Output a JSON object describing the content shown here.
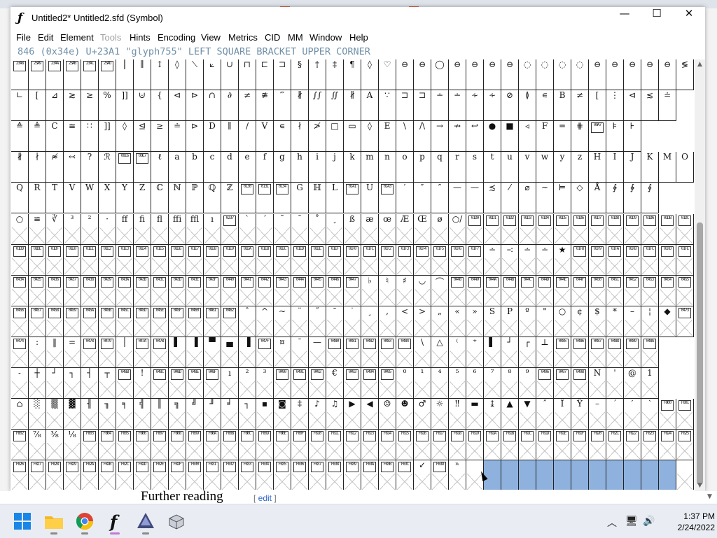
{
  "window": {
    "title": "Untitled2*  Untitled2.sfd (Symbol)",
    "controls": {
      "minimize": "—",
      "maximize": "☐",
      "close": "✕"
    }
  },
  "menu": [
    "File",
    "Edit",
    "Element",
    "Tools",
    "Hints",
    "Encoding",
    "View",
    "Metrics",
    "CID",
    "MM",
    "Window",
    "Help"
  ],
  "info_line": "846 (0x34e) U+23A1 \"glyph755\" LEFT SQUARE BRACKET UPPER CORNER",
  "grid": {
    "rows": [
      [
        "23A8",
        "23A9",
        "23AA",
        "23AB",
        "23AC",
        "23AD",
        "⎮",
        "∥",
        "↕",
        "◊",
        "⟍",
        "⟀",
        "∪",
        "⊓",
        "⊏",
        "⊐",
        "§",
        "†",
        "‡",
        "¶",
        "◊",
        "♡",
        "⊖",
        "⊖",
        "◯",
        "⊖",
        "⊖",
        "⊖",
        "⊖",
        "◌",
        "◌",
        "◌",
        "◌",
        "⊖",
        "⊖",
        "⊖",
        "⊖",
        "⊖",
        "≶"
      ],
      [
        "∟",
        "[",
        "⊿",
        "≳",
        "≥",
        "%",
        "]]",
        "⊍",
        "{",
        "⊲",
        "⊳",
        "∩",
        "∂",
        "≠",
        "≇",
        "‴",
        "∦",
        "∫∫",
        "∬",
        "∦",
        "A",
        "∵",
        "⊐",
        "⊐",
        "∸",
        "∸",
        "∻",
        "∻",
        "⊘",
        "≬",
        "∊",
        "B",
        "≠",
        "[",
        "⋮",
        "⊲",
        "≲",
        "≐"
      ],
      [
        "≙",
        "≜",
        "C",
        "≅",
        "∷",
        "]]",
        "◊",
        "⊴",
        "≥",
        "≐",
        "⊳",
        "D",
        "∥",
        "/",
        "V",
        "∊",
        "∤",
        "≯",
        "□",
        "▭",
        "◊",
        "E",
        "\\",
        "/\\",
        "→",
        "↛",
        "↩",
        "●",
        "■",
        "◃",
        "F",
        "═",
        "⋕",
        "00A7",
        "⊧",
        "⊦"
      ],
      [
        "∦",
        "∤",
        "≉",
        "↢",
        "?",
        "ℛ",
        "00E6",
        "00E7",
        "ℓ",
        "a",
        "b",
        "c",
        "d",
        "e",
        "f",
        "g",
        "h",
        "i",
        "j",
        "k",
        "m",
        "n",
        "o",
        "p",
        "q",
        "r",
        "s",
        "t",
        "u",
        "v",
        "w",
        "y",
        "z",
        "H",
        "I",
        "J",
        "K",
        "M",
        "O"
      ],
      [
        "Q",
        "R",
        "T",
        "V",
        "W",
        "X",
        "Y",
        "Z",
        "ℂ",
        "ℕ",
        "ℙ",
        "ℚ",
        "ℤ",
        "0130",
        "0131",
        "0134",
        "G",
        "ℍ",
        "L",
        "0141",
        "U",
        "0143",
        "′",
        "″",
        "″",
        "—",
        "—",
        "≾",
        "⁄",
        "⌀",
        "∼",
        "⊨",
        "◇",
        "Å",
        "∲",
        "∳",
        "∮"
      ],
      [
        "○",
        "≌",
        "∛",
        "³",
        "²",
        "·",
        "ff",
        "fi",
        "fl",
        "ffi",
        "ffl",
        "ı",
        "0237",
        "`",
        "´",
        "˘",
        "ˉ",
        "˚",
        "¸",
        "ß",
        "æ",
        "œ",
        "Æ",
        "Œ",
        "ø",
        "○/",
        "01D0",
        "01D1",
        "01D2",
        "01D3",
        "01D4",
        "01D5",
        "01D6",
        "01D7",
        "01D8",
        "01D9",
        "01DA",
        "01DB",
        "01DC"
      ],
      [
        "01DD",
        "01DE",
        "01DF",
        "01E0",
        "01E1",
        "01E2",
        "01E3",
        "01E4",
        "01E5",
        "01E6",
        "01E7",
        "01E8",
        "01E9",
        "01EA",
        "01EB",
        "01EC",
        "01ED",
        "01EE",
        "01EF",
        "01F0",
        "01F1",
        "01F2",
        "01F3",
        "01F4",
        "01F5",
        "01F6",
        "01F7",
        "∸",
        "∹",
        "∸",
        "∸",
        "★",
        "01F8",
        "01F9",
        "01FA",
        "01FB",
        "01FC",
        "01FD",
        "01FE"
      ],
      [
        "0434",
        "0435",
        "0436",
        "0437",
        "0438",
        "0439",
        "043A",
        "043B",
        "043C",
        "043D",
        "043E",
        "043F",
        "0440",
        "0441",
        "0442",
        "0443",
        "0444",
        "0445",
        "0446",
        "0447",
        "♭",
        "♮",
        "♯",
        "◡",
        "⌒",
        "0448",
        "0449",
        "044A",
        "044B",
        "044C",
        "044D",
        "044E",
        "044F",
        "0450",
        "0451",
        "0452",
        "0453",
        "0454",
        "0455"
      ],
      [
        "0456",
        "0457",
        "0458",
        "0459",
        "045A",
        "045B",
        "045C",
        "045D",
        "045E",
        "045F",
        "0460",
        "0461",
        "0462",
        "ˆ",
        "^",
        "~",
        "¨",
        "˝",
        "¯",
        "˙",
        "¸",
        ",",
        "<",
        ">",
        "„",
        "«",
        "»",
        "S",
        "P",
        "º",
        "\"",
        "○",
        "¢",
        "$",
        "*",
        "–",
        "¦",
        "◆",
        "0473"
      ],
      [
        "0474",
        ":",
        "‖",
        "=",
        "0478",
        "0479",
        "│",
        "047A",
        "047B",
        "▌",
        "▐",
        "▀",
        "▄",
        "▐",
        "047F",
        "¤",
        "ˉ",
        "—",
        "0480",
        "0481",
        "0482",
        "0483",
        "0484",
        "\\",
        "△",
        "⁽",
        "⁺",
        "▌",
        "┘",
        "┌",
        "⊥",
        "0485",
        "0486",
        "0487",
        "0488",
        "0489",
        "048A"
      ],
      [
        "˗",
        "┼",
        "┘",
        "┐",
        "┤",
        "┬",
        "048B",
        "!",
        "048C",
        "048D",
        "048E",
        "048F",
        "ı",
        "²",
        "³",
        "0490",
        "0491",
        "0492",
        "€",
        "0493",
        "0494",
        "0495",
        "⁰",
        "¹",
        "⁴",
        "⁵",
        "⁶",
        "⁷",
        "⁸",
        "⁹",
        "0496",
        "0497",
        "0498",
        "N",
        "'",
        "@",
        "1"
      ],
      [
        "⌂",
        "░",
        "▒",
        "▓",
        "╢",
        "╖",
        "╕",
        "╣",
        "║",
        "╗",
        "╝",
        "╜",
        "╛",
        "┐",
        "▪",
        "◙",
        "‡",
        "♪",
        "♫",
        "▶",
        "◀",
        "☺",
        "☻",
        "♂",
        "☼",
        "‼",
        "▬",
        "↨",
        "▲",
        "▼",
        "˝",
        "Ï",
        "Ÿ",
        "–",
        "´",
        "′",
        "‵",
        "F800",
        "F801"
      ],
      [
        "F802",
        "⅞",
        "⅜",
        "⅛",
        "F803",
        "F804",
        "F805",
        "F806",
        "F807",
        "F808",
        "F809",
        "F80A",
        "F80B",
        "F80C",
        "F80D",
        "F80E",
        "F80F",
        "F810",
        "F811",
        "F812",
        "F813",
        "F814",
        "F815",
        "F816",
        "F817",
        "F818",
        "F819",
        "F81A",
        "F81B",
        "F81C",
        "F81D",
        "F81E",
        "F81F",
        "F820",
        "F821",
        "F822",
        "F823",
        "F824",
        "F825"
      ],
      [
        "F826",
        "F827",
        "F828",
        "F829",
        "F82A",
        "F82B",
        "F82C",
        "F82D",
        "F82E",
        "F82F",
        "F830",
        "F831",
        "F832",
        "F833",
        "F834",
        "F835",
        "F836",
        "F837",
        "F838",
        "F839",
        "F83A",
        "F83B",
        "F83C",
        "✓",
        "F83D",
        "ⁿ",
        "",
        "",
        "",
        "",
        "",
        "",
        "",
        "",
        "",
        "",
        "",
        "",
        ""
      ]
    ]
  },
  "background_page": {
    "heading": "Further reading",
    "edit_link": "edit"
  },
  "taskbar": {
    "apps": [
      "start-icon",
      "file-explorer-icon",
      "chrome-icon",
      "fontforge-icon",
      "inkscape-icon",
      "app-icon"
    ],
    "time": "1:37 PM",
    "date": "2/24/2022"
  }
}
